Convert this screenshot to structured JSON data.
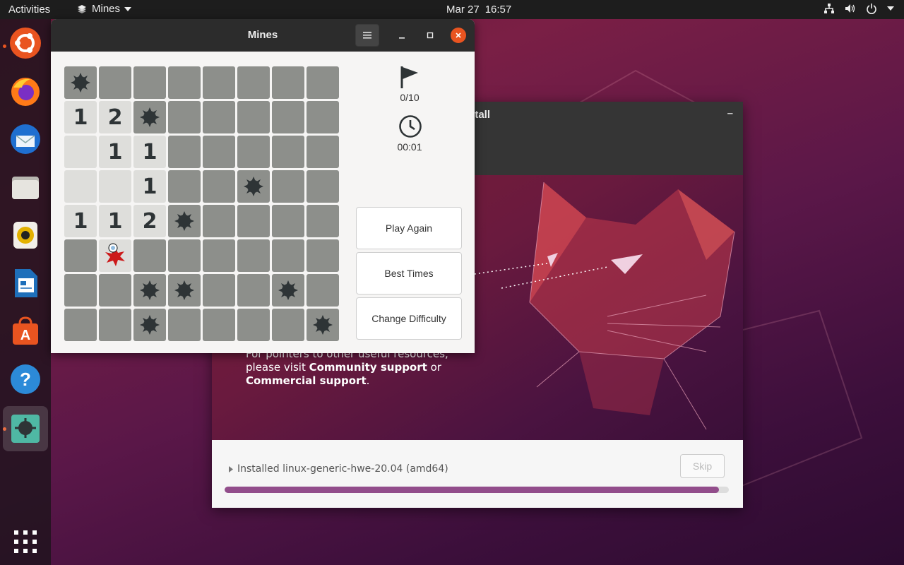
{
  "topbar": {
    "activities": "Activities",
    "app_name": "Mines",
    "date": "Mar 27",
    "time": "16:57"
  },
  "dock": {
    "items": [
      "ubuntu-software-logo",
      "firefox",
      "thunderbird",
      "files",
      "rhythmbox",
      "libreoffice-writer",
      "ubuntu-software",
      "help",
      "mines"
    ],
    "show_apps": "show-applications"
  },
  "installer": {
    "title": "stall",
    "slide_text_1": "For pointers to other useful resources, please visit ",
    "community_link": "Community support",
    "or_word": " or ",
    "commercial_link": "Commercial support",
    "period": ".",
    "status": "Installed linux-generic-hwe-20.04 (amd64)",
    "skip_label": "Skip",
    "progress_percent": 98
  },
  "mines": {
    "title": "Mines",
    "flags": "0/10",
    "time": "00:01",
    "buttons": {
      "play_again": "Play Again",
      "best_times": "Best Times",
      "change_difficulty": "Change Difficulty"
    },
    "grid": [
      [
        "M",
        "C",
        "C",
        "C",
        "C",
        "C",
        "C",
        "C"
      ],
      [
        "1",
        "2",
        "M",
        "C",
        "C",
        "C",
        "C",
        "C"
      ],
      [
        "O",
        "1",
        "1",
        "C",
        "C",
        "C",
        "C",
        "C"
      ],
      [
        "O",
        "O",
        "1",
        "C",
        "C",
        "M",
        "C",
        "C"
      ],
      [
        "1",
        "1",
        "2",
        "M",
        "C",
        "C",
        "C",
        "C"
      ],
      [
        "C",
        "X",
        "C",
        "C",
        "C",
        "C",
        "C",
        "C"
      ],
      [
        "C",
        "C",
        "M",
        "M",
        "C",
        "C",
        "M",
        "C"
      ],
      [
        "C",
        "C",
        "M",
        "C",
        "C",
        "C",
        "C",
        "M"
      ]
    ]
  }
}
